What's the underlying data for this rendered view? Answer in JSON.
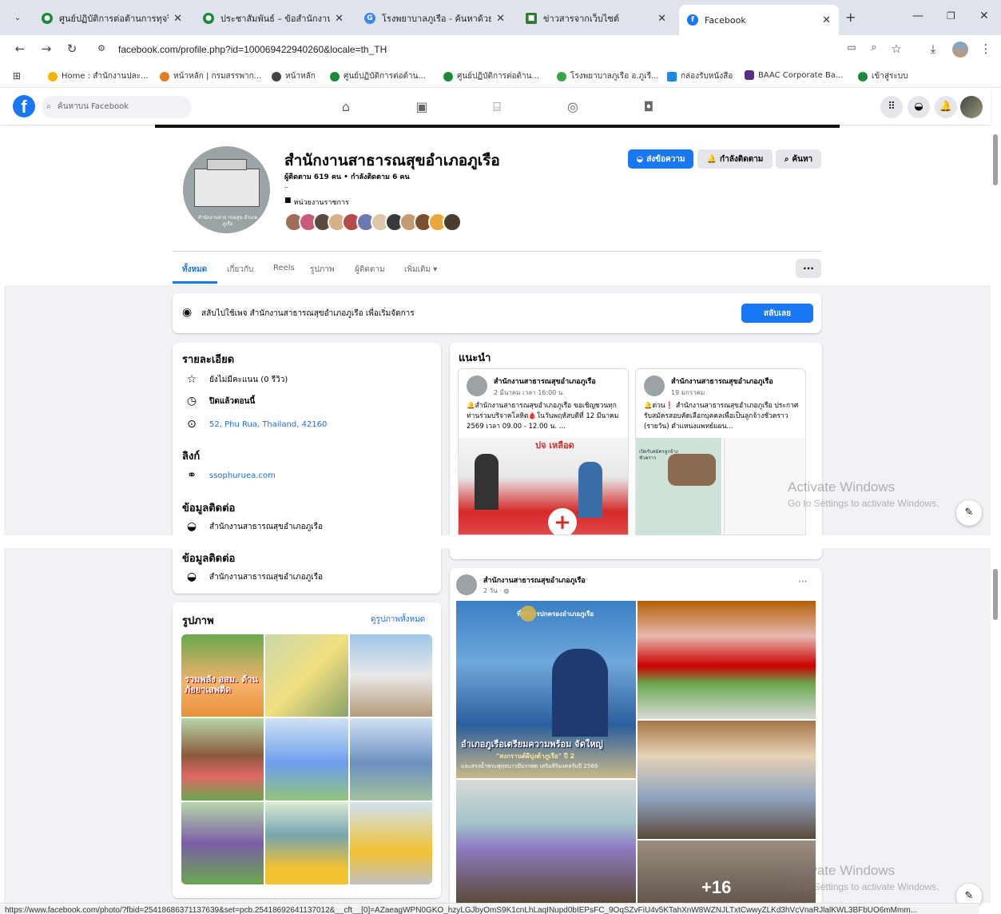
{
  "browser": {
    "tabs": [
      {
        "title": "ศูนย์ปฏิบัติการต่อต้านการทุจริต",
        "color": "#1a8a3a"
      },
      {
        "title": "ประชาสัมพันธ์ – ข้อสำนักงานสาธ",
        "color": "#1a8a3a"
      },
      {
        "title": "โรงพยาบาลภูเรือ - ค้นหาด้วย Go",
        "color": "#4285f4"
      },
      {
        "title": "ข่าวสารจากเว็บไซต์",
        "color": "#2e7d32"
      },
      {
        "title": "Facebook",
        "color": "#1877f2"
      }
    ],
    "url": "facebook.com/profile.php?id=100069422940260&locale=th_TH",
    "bookmarks": [
      {
        "label": "Home : สำนักงานปละ...",
        "color": "#f4b400"
      },
      {
        "label": "หน้าหลัก | กรมสรรพาก...",
        "color": "#e67c22"
      },
      {
        "label": "หน้าหลัก",
        "color": "#444444"
      },
      {
        "label": "ศูนย์ปฏิบัติการต่อต้าน...",
        "color": "#1a8a3a"
      },
      {
        "label": "ศูนย์ปฏิบัติการต่อต้าน...",
        "color": "#1a8a3a"
      },
      {
        "label": "โรงพยาบาลภูเรือ อ.ภูเรื...",
        "color": "#3aa346"
      },
      {
        "label": "กล่องรับหนังสือ",
        "color": "#1e88e5"
      },
      {
        "label": "BAAC Corporate Ba...",
        "color": "#5a2d82"
      },
      {
        "label": "เข้าสู่ระบบ",
        "color": "#1a8a3a"
      }
    ],
    "status_url": "https://www.facebook.com/photo/?fbid=25418686371137639&set=pcb.25418692641137012&__cft__[0]=AZaeagWPN0GKO_hzyLGJbyOmS9K1cnLhLaqINupd0bIEPsFC_9OqSZvFiU4v5KTahXnW8WZNJLTxtCwwyZLKd3hVcVnaRJlalKWL3BFbUO6mMmm...",
    "watermark_title": "Activate Windows",
    "watermark_sub": "Go to Settings to activate Windows."
  },
  "fb": {
    "search_placeholder": "ค้นหาบน Facebook",
    "page_name": "สำนักงานสาธารณสุขอำเภอภูเรือ",
    "followers": "ผู้ติดตาม 619 คน • กำลังติดตาม 6 คน",
    "dots": "..",
    "category": "หน่วยงานราชการ",
    "avatar_caption": "สำนักงานสาธารณสุข อำเภอภูเรือ",
    "btn_message": "ส่งข้อความ",
    "btn_following": "กำลังติดตาม",
    "btn_search": "ค้นหา",
    "tabs": [
      "ทั้งหมด",
      "เกี่ยวกับ",
      "Reels",
      "รูปภาพ",
      "ผู้ติดตาม",
      "เพิ่มเติม ▾"
    ],
    "switch_text": "สลับไปใช้เพจ สำนักงานสาธารณสุขอำเภอภูเรือ เพื่อเริ่มจัดการ",
    "switch_btn": "สลับเลย",
    "details_title": "รายละเอียด",
    "rating": "ยังไม่มีคะแนน (0 รีวิว)",
    "status": "ปิดแล้วตอนนี้",
    "address": "52, Phu Rua, Thailand, 42160",
    "links_title": "ลิงก์",
    "website": "ssophuruea.com",
    "contact_title": "ข้อมูลติดต่อ",
    "contact_name": "สำนักงานสาธารณสุขอำเภอภูเรือ",
    "featured_title": "แนะนำ",
    "featured": [
      {
        "author": "สำนักงานสาธารณสุขอำเภอภูเรือ",
        "date": "2 มีนาคม เวลา 16:00 น.",
        "text": "🔔สำนักงานสาธารณสุขอำเภอภูเรือ ขอเชิญชวนทุกท่านร่วมบริจาคโลหิต🩸ในวันพฤหัสบดีที่ 12 มีนาคม 2569 เวลา 09.00 - 12.00 น. ...",
        "banner": "ปจ เหลือด"
      },
      {
        "author": "สำนักงานสาธารณสุขอำเภอภูเรือ",
        "date": "19 มกราคม",
        "text": "🔔ด่วน❗ สำนักงานสาธารณสุขอำเภอภูเรือ ประกาศรับสมัครสอบคัดเลือกบุคคลเพื่อเป็นลูกจ้างชั่วคราว (รายวัน) ตำแหน่งแพทย์แผน...",
        "banner": "เปิดรับสมัครลูกจ้างชั่วคราว"
      }
    ],
    "photos_title": "รูปภาพ",
    "photos_link": "ดูรูปภาพทั้งหมด",
    "photo_texts": {
      "p1": "รวมพลัง อสม. ต้านภัยยาเสพติด"
    },
    "post": {
      "author": "สำนักงานสาธารณสุขอำเภอภูเรือ",
      "time": "2 วัน · ",
      "banner_top": "ที่ทำการปกครองอำเภอภูเรือ",
      "banner_main": "อำเภอภูเรือเตรียมความพร้อม จัดใหญ่",
      "banner_sub": "\"สงกรานต์ผีบุ่งต้าภูเรือ\" ปี 2",
      "banner_sub2": "และสรงน้ำพระพุทธบารมีบรรพต เสริมสิริมงคลรับปี 2569",
      "more_count": "+16"
    }
  }
}
